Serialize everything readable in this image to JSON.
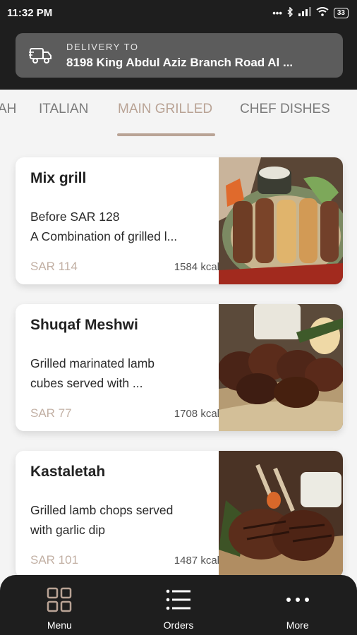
{
  "status_bar": {
    "time": "11:32 PM",
    "signal_text": "•••",
    "battery": "33"
  },
  "delivery": {
    "label": "DELIVERY TO",
    "address": "8198 King Abdul Aziz Branch Road Al ..."
  },
  "tabs": [
    {
      "label": "AH"
    },
    {
      "label": "ITALIAN"
    },
    {
      "label": "MAIN GRILLED",
      "active": true
    },
    {
      "label": "CHEF DISHES"
    }
  ],
  "items": [
    {
      "title": "Mix grill",
      "desc_line1": "Before SAR 128",
      "desc_line2": "A Combination of grilled l...",
      "price": "SAR 114",
      "kcal": "1584 kcal"
    },
    {
      "title": "Shuqaf Meshwi",
      "desc_line1": "Grilled marinated lamb",
      "desc_line2": "cubes served with ...",
      "price": "SAR 77",
      "kcal": "1708 kcal"
    },
    {
      "title": "Kastaletah",
      "desc_line1": "Grilled lamb chops served",
      "desc_line2": "with garlic dip",
      "price": "SAR 101",
      "kcal": "1487 kcal"
    }
  ],
  "nav": [
    {
      "label": "Menu",
      "icon": "grid-icon"
    },
    {
      "label": "Orders",
      "icon": "list-icon"
    },
    {
      "label": "More",
      "icon": "more-dots-icon"
    }
  ],
  "colors": {
    "accent": "#b9a395",
    "header_bg": "#1e1e1e",
    "delivery_box": "#5c5c5c",
    "price": "#c2b0a4"
  }
}
